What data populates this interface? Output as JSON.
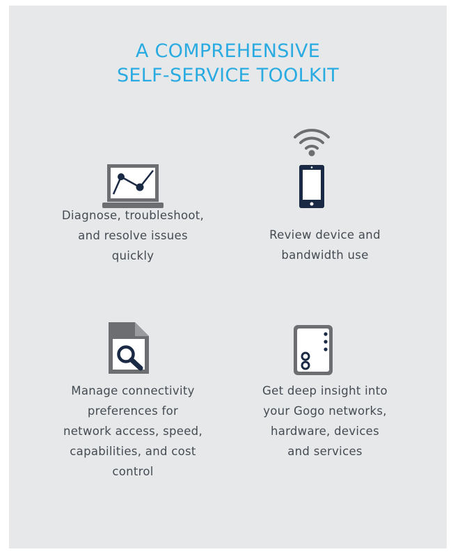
{
  "title": {
    "line1": "A COMPREHENSIVE",
    "line2": "SELF-SERVICE TOOLKIT"
  },
  "features": [
    {
      "icon": "laptop-chart-icon",
      "lines": [
        "Diagnose, troubleshoot,",
        "and resolve issues",
        "quickly"
      ]
    },
    {
      "icon": "smartphone-wifi-icon",
      "lines": [
        "Review device and",
        "bandwidth use"
      ]
    },
    {
      "icon": "document-search-icon",
      "lines": [
        "Manage connectivity",
        "preferences for",
        "network access, speed,",
        "capabilities, and cost",
        "control"
      ]
    },
    {
      "icon": "hardware-unit-icon",
      "lines": [
        "Get deep insight into",
        "your Gogo networks,",
        "hardware, devices",
        "and services"
      ]
    }
  ],
  "colors": {
    "panel_background": "#e7e8e9",
    "title": "#29abe2",
    "text": "#444b53",
    "icon_gray": "#6d6e71",
    "icon_navy": "#1b2a44"
  }
}
